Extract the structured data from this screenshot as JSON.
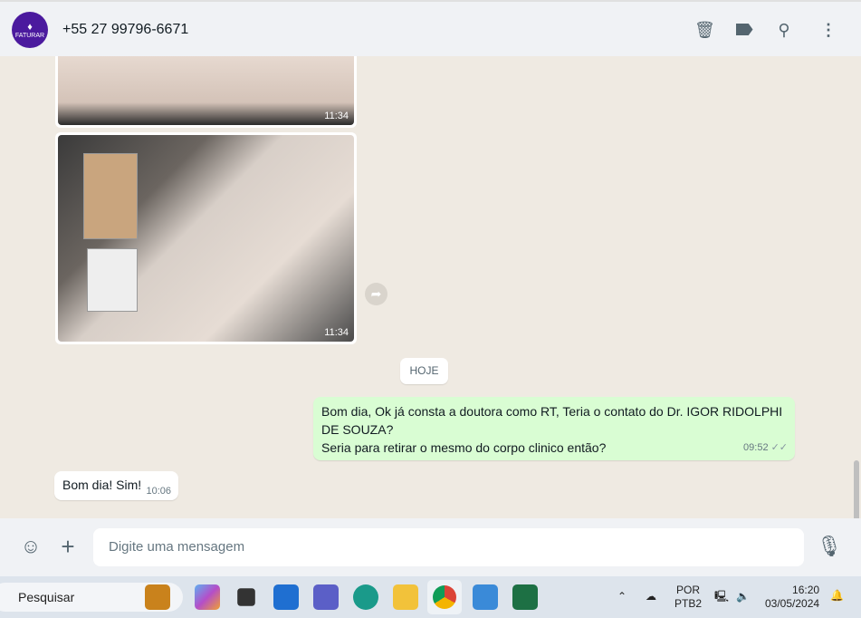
{
  "header": {
    "avatar_text": "FATURAR",
    "contact": "+55 27 99796-6671",
    "icons": [
      "trash-icon",
      "label-icon",
      "search-icon",
      "more-icon"
    ]
  },
  "messages": {
    "image1_time": "11:34",
    "image2_time": "11:34",
    "date_chip": "HOJE",
    "outgoing": {
      "line1": "Bom dia, Ok já consta a doutora como RT, Teria o contato do Dr. IGOR RIDOLPHI DE SOUZA?",
      "line2": "Seria para retirar o mesmo do corpo clinico então?",
      "time": "09:52",
      "ticks": "✓✓"
    },
    "incoming": {
      "text": "Bom dia! Sim!",
      "time": "10:06"
    }
  },
  "input": {
    "placeholder": "Digite uma mensagem"
  },
  "taskbar": {
    "search": "Pesquisar",
    "lang1": "POR",
    "lang2": "PTB2",
    "time": "16:20",
    "date": "03/05/2024"
  }
}
